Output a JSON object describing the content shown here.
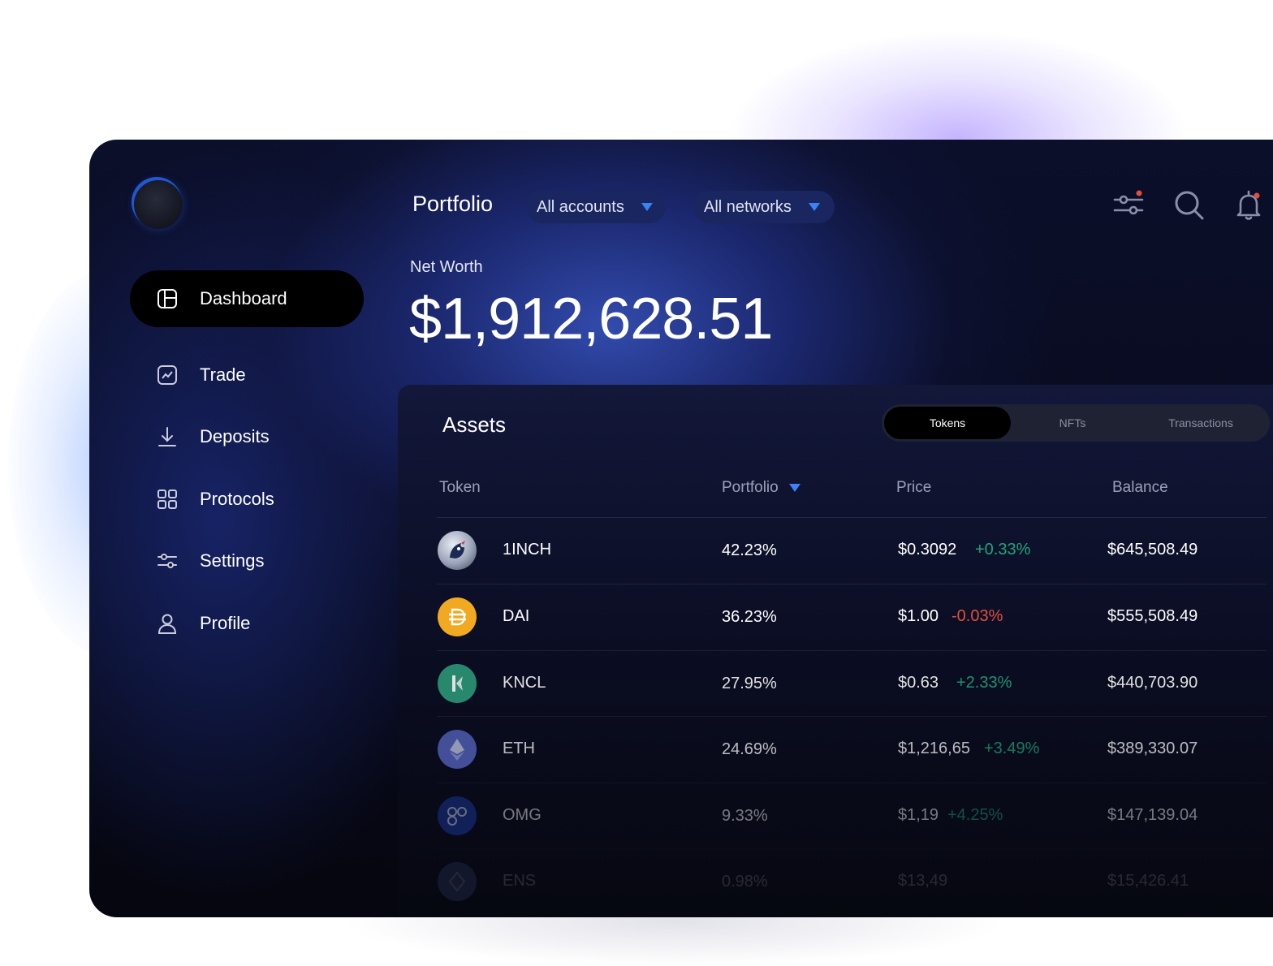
{
  "header": {
    "title": "Portfolio"
  },
  "filters": {
    "accounts": "All accounts",
    "networks": "All networks"
  },
  "icons": [
    "sliders-icon",
    "search-icon",
    "bell-icon"
  ],
  "sidebar": {
    "items": [
      {
        "label": "Dashboard",
        "icon": "dashboard-icon",
        "active": true
      },
      {
        "label": "Trade",
        "icon": "chart-icon"
      },
      {
        "label": "Deposits",
        "icon": "download-icon"
      },
      {
        "label": "Protocols",
        "icon": "grid-icon"
      },
      {
        "label": "Settings",
        "icon": "sliders-icon"
      },
      {
        "label": "Profile",
        "icon": "user-icon"
      }
    ]
  },
  "networth": {
    "label": "Net Worth",
    "value": "$1,912,628.51"
  },
  "assets": {
    "title": "Assets",
    "tabs": [
      "Tokens",
      "NFTs",
      "Transactions"
    ],
    "columns": {
      "token": "Token",
      "portfolio": "Portfolio",
      "price": "Price",
      "balance": "Balance"
    },
    "rows": [
      {
        "symbol": "1INCH",
        "portfolio": "42.23%",
        "price": "$0.3092",
        "change": "+0.33%",
        "balance": "$645,508.49"
      },
      {
        "symbol": "DAI",
        "portfolio": "36.23%",
        "price": "$1.00",
        "change": "-0.03%",
        "balance": "$555,508.49"
      },
      {
        "symbol": "KNCL",
        "portfolio": "27.95%",
        "price": "$0.63",
        "change": "+2.33%",
        "balance": "$440,703.90"
      },
      {
        "symbol": "ETH",
        "portfolio": "24.69%",
        "price": "$1,216,65",
        "change": "+3.49%",
        "balance": "$389,330.07"
      },
      {
        "symbol": "OMG",
        "portfolio": "9.33%",
        "price": "$1,19",
        "change": "+4.25%",
        "balance": "$147,139.04"
      },
      {
        "symbol": "ENS",
        "portfolio": "0.98%",
        "price": "$13,49",
        "change": "",
        "balance": "$15,426.41"
      }
    ]
  },
  "colors": {
    "accent": "#2f6bf0",
    "positive": "#1fa57a",
    "negative": "#e0503e",
    "notification": "#e0503e"
  }
}
